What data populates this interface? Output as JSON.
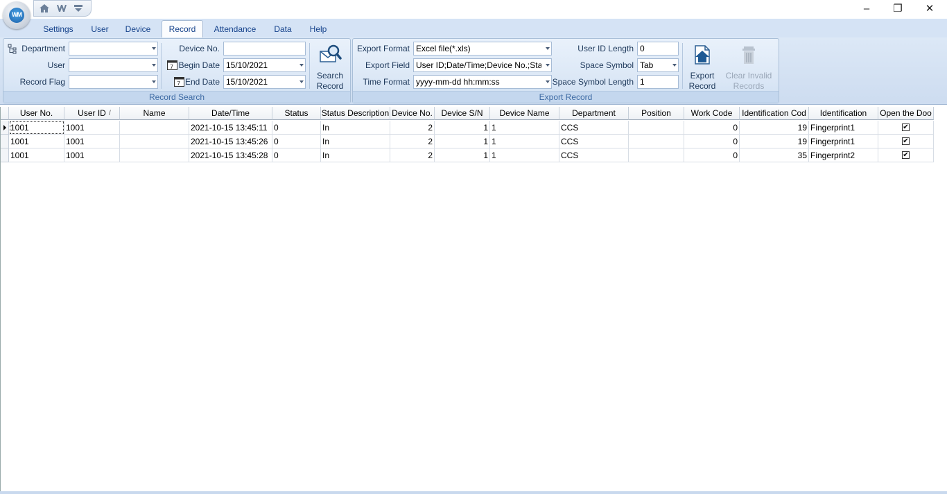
{
  "window": {
    "minimize": "–",
    "restore": "❐",
    "close": "✕"
  },
  "app_logo_text": "WM",
  "tabs": [
    "Settings",
    "User",
    "Device",
    "Record",
    "Attendance",
    "Data",
    "Help"
  ],
  "active_tab": "Record",
  "record_search": {
    "group_label": "Record Search",
    "department_label": "Department",
    "department_value": "",
    "user_label": "User",
    "user_value": "",
    "record_flag_label": "Record Flag",
    "record_flag_value": "",
    "device_no_label": "Device No.",
    "device_no_value": "",
    "begin_date_label": "Begin Date",
    "begin_date_value": "15/10/2021",
    "end_date_label": "End Date",
    "end_date_value": "15/10/2021",
    "search_button_line1": "Search",
    "search_button_line2": "Record"
  },
  "export_record": {
    "group_label": "Export Record",
    "export_format_label": "Export Format",
    "export_format_value": "Excel file(*.xls)",
    "export_field_label": "Export Field",
    "export_field_value": "User ID;Date/Time;Device No.;Statu",
    "time_format_label": "Time Format",
    "time_format_value": "yyyy-mm-dd hh:mm:ss",
    "user_id_length_label": "User ID Length",
    "user_id_length_value": "0",
    "space_symbol_label": "Space Symbol",
    "space_symbol_value": "Tab",
    "space_symbol_length_label": "Space Symbol Length",
    "space_symbol_length_value": "1",
    "export_button_line1": "Export",
    "export_button_line2": "Record",
    "clear_button_line1": "Clear Invalid",
    "clear_button_line2": "Records"
  },
  "grid": {
    "columns": [
      "User No.",
      "User ID",
      "Name",
      "Date/Time",
      "Status",
      "Status Description",
      "Device No.",
      "Device S/N",
      "Device Name",
      "Department",
      "Position",
      "Work Code",
      "Identification Cod",
      "Identification",
      "Open the Doo"
    ],
    "sort_indicator": "/",
    "rows": [
      [
        "1001",
        "1001",
        "",
        "2021-10-15 13:45:11",
        "0",
        "In",
        "2",
        "1",
        "1",
        "CCS",
        "",
        "0",
        "19",
        "Fingerprint1",
        "✔"
      ],
      [
        "1001",
        "1001",
        "",
        "2021-10-15 13:45:26",
        "0",
        "In",
        "2",
        "1",
        "1",
        "CCS",
        "",
        "0",
        "19",
        "Fingerprint1",
        "✔"
      ],
      [
        "1001",
        "1001",
        "",
        "2021-10-15 13:45:28",
        "0",
        "In",
        "2",
        "1",
        "1",
        "CCS",
        "",
        "0",
        "35",
        "Fingerprint2",
        "✔"
      ]
    ]
  },
  "colors": {
    "accent": "#15428b",
    "ribbon": "#dce8f6",
    "tab_strip": "#d5e3f5"
  }
}
